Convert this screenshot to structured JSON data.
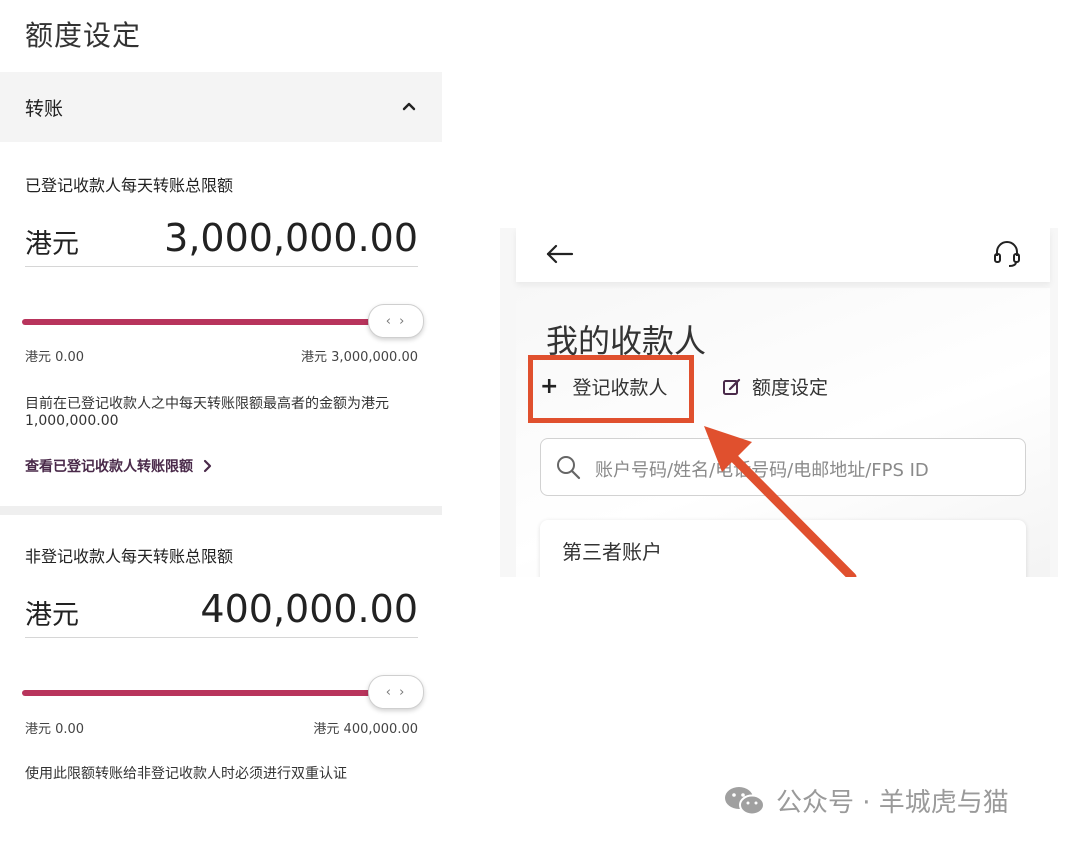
{
  "page_title": "额度设定",
  "transfer_section": {
    "title": "转账",
    "registered": {
      "label": "已登记收款人每天转账总限额",
      "currency": "港元",
      "amount": "3,000,000.00",
      "slider_level": 1.0,
      "range_min": "港元 0.00",
      "range_max": "港元 3,000,000.00",
      "note": "目前在已登记收款人之中每天转账限额最高者的金额为港元1,000,000.00",
      "link": "查看已登记收款人转账限额"
    },
    "unregistered": {
      "label": "非登记收款人每天转账总限额",
      "currency": "港元",
      "amount": "400,000.00",
      "slider_level": 1.0,
      "range_min": "港元 0.00",
      "range_max": "港元 400,000.00",
      "note": "使用此限额转账给非登记收款人时必须进行双重认证"
    },
    "slider_thumb_glyph": "‹ ›"
  },
  "app_screen": {
    "heading": "我的收款人",
    "register_label": "登记收款人",
    "register_plus": "+",
    "limit_label": "额度设定",
    "search_placeholder": "账户号码/姓名/电话号码/电邮地址/FPS ID",
    "third_party_label": "第三者账户"
  },
  "watermark": {
    "text": "公众号 · 羊城虎与猫"
  },
  "colors": {
    "slider_accent": "#b8345c",
    "highlight": "#e0502e",
    "link": "#4a2a4a"
  },
  "icons": [
    "chevron-up-icon",
    "back-arrow-icon",
    "headset-icon",
    "edit-icon",
    "search-icon",
    "wechat-icon"
  ]
}
